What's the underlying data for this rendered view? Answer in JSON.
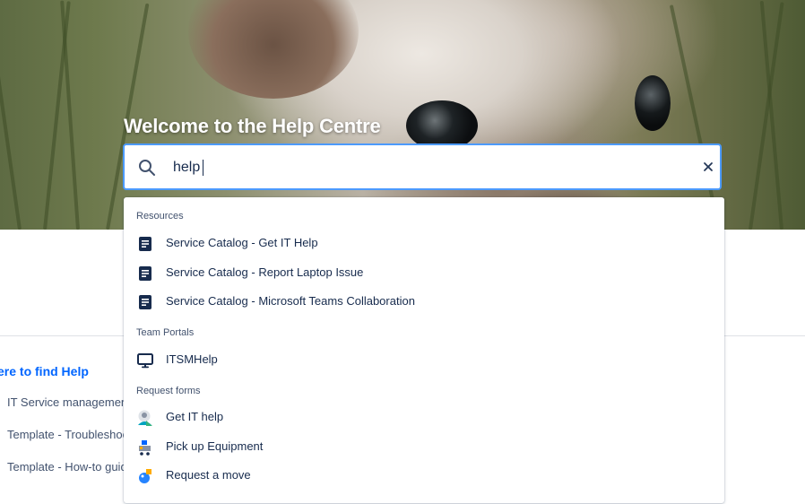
{
  "hero": {
    "title": "Welcome to the Help Centre"
  },
  "search": {
    "value": "help"
  },
  "dropdown": {
    "groups": [
      {
        "label": "Resources",
        "items": [
          {
            "label": "Service Catalog - Get IT Help",
            "icon": "article-icon"
          },
          {
            "label": "Service Catalog - Report Laptop Issue",
            "icon": "article-icon"
          },
          {
            "label": "Service Catalog - Microsoft Teams Collaboration",
            "icon": "article-icon"
          }
        ]
      },
      {
        "label": "Team Portals",
        "items": [
          {
            "label": "ITSMHelp",
            "icon": "monitor-icon"
          }
        ]
      },
      {
        "label": "Request forms",
        "items": [
          {
            "label": "Get IT help",
            "icon": "support-agent-icon"
          },
          {
            "label": "Pick up Equipment",
            "icon": "equipment-cart-icon"
          },
          {
            "label": "Request a move",
            "icon": "move-boxes-icon"
          }
        ]
      }
    ]
  },
  "background": {
    "heading": "ere to find Help",
    "links": [
      "IT Service management",
      "Template - Troubleshoo",
      "Template - How-to guid"
    ]
  },
  "colors": {
    "accent": "#4c9aff",
    "link": "#0065ff",
    "text": "#172b4d",
    "icon": "#172b4d"
  }
}
